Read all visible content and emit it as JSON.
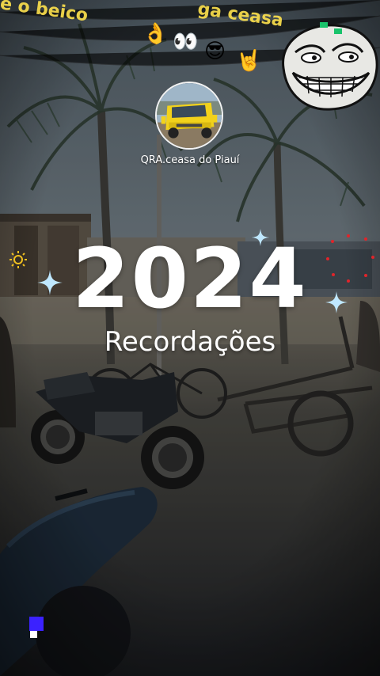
{
  "profile": {
    "account_name": "QRA.ceasa do Piauí",
    "avatar": "yellow-truck-photo"
  },
  "title": {
    "year": "2024",
    "subtitle": "Recordações"
  },
  "overlay_caption": {
    "left_fragment": "e o beico",
    "right_fragment": "ga ceasa"
  },
  "stickers": {
    "emojis": [
      "👌",
      "👀",
      "😎",
      "🤘"
    ],
    "meme": "trollface-icon"
  },
  "colors": {
    "text": "#ffffff",
    "caption": "#ffe34d",
    "sparkle": "#bfe8ff",
    "truck": "#f2d21b"
  }
}
